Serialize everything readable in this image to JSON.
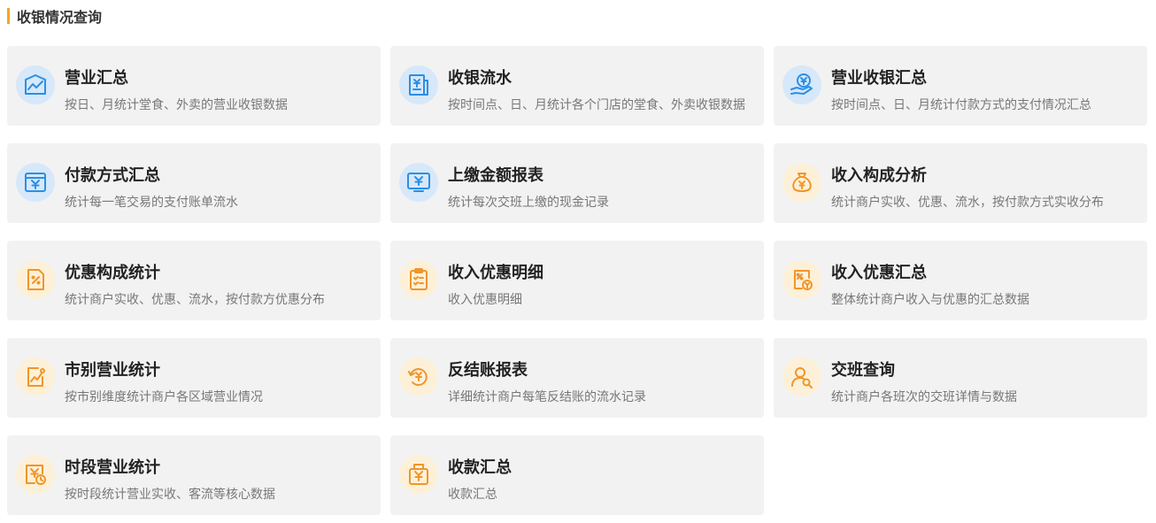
{
  "section": {
    "title": "收银情况查询"
  },
  "colors": {
    "accent": "#f5a623",
    "blue_icon": "#2b8fe6",
    "orange_icon": "#f0962a",
    "card_bg": "#f2f2f2"
  },
  "cards": [
    {
      "title": "营业汇总",
      "desc": "按日、月统计堂食、外卖的营业收银数据",
      "icon": "chart-icon"
    },
    {
      "title": "收银流水",
      "desc": "按时间点、日、月统计各个门店的堂食、外卖收银数据",
      "icon": "receipt-icon"
    },
    {
      "title": "营业收银汇总",
      "desc": "按时间点、日、月统计付款方式的支付情况汇总",
      "icon": "hand-coin-icon"
    },
    {
      "title": "付款方式汇总",
      "desc": "统计每一笔交易的支付账单流水",
      "icon": "payment-window-icon"
    },
    {
      "title": "上缴金额报表",
      "desc": "统计每次交班上缴的现金记录",
      "icon": "monitor-yen-icon"
    },
    {
      "title": "收入构成分析",
      "desc": "统计商户实收、优惠、流水，按付款方式实收分布",
      "icon": "money-bag-icon"
    },
    {
      "title": "优惠构成统计",
      "desc": "统计商户实收、优惠、流水，按付款方优惠分布",
      "icon": "discount-doc-icon"
    },
    {
      "title": "收入优惠明细",
      "desc": "收入优惠明细",
      "icon": "clipboard-list-icon"
    },
    {
      "title": "收入优惠汇总",
      "desc": "整体统计商户收入与优惠的汇总数据",
      "icon": "discount-coin-icon"
    },
    {
      "title": "市别营业统计",
      "desc": "按市别维度统计商户各区域营业情况",
      "icon": "trend-doc-icon"
    },
    {
      "title": "反结账报表",
      "desc": "详细统计商户每笔反结账的流水记录",
      "icon": "refresh-yen-icon"
    },
    {
      "title": "交班查询",
      "desc": "统计商户各班次的交班详情与数据",
      "icon": "user-search-icon"
    },
    {
      "title": "时段营业统计",
      "desc": "按时段统计营业实收、客流等核心数据",
      "icon": "clock-yen-icon"
    },
    {
      "title": "收款汇总",
      "desc": "收款汇总",
      "icon": "register-yen-icon"
    }
  ]
}
